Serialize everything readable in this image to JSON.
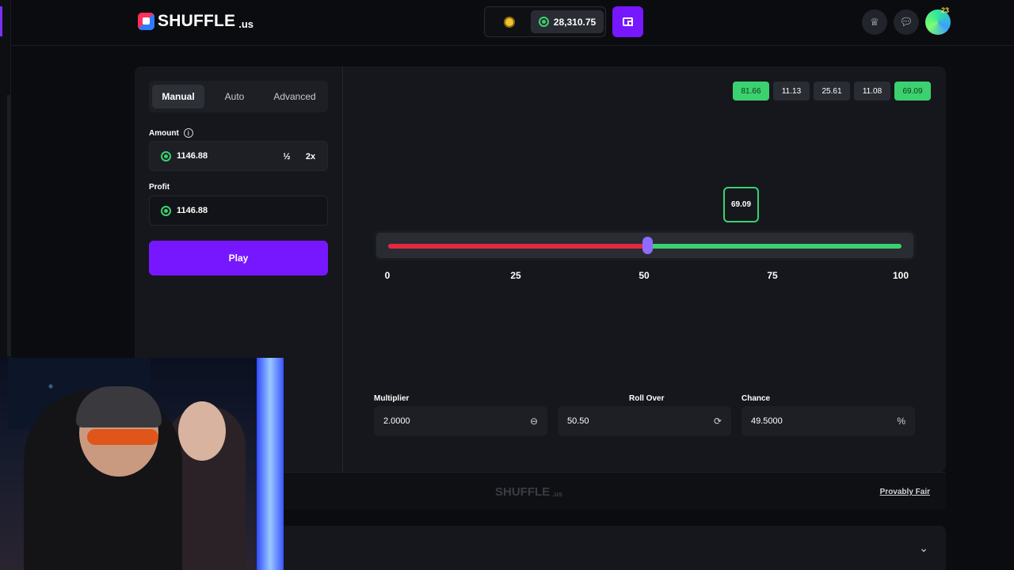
{
  "header": {
    "logo_text": "SHUFFLE",
    "logo_suffix": ".us",
    "balance": "28,310.75",
    "icons": [
      "coin-icon",
      "wallet-icon",
      "crown-icon",
      "chat-icon"
    ],
    "avatar_badge": "23"
  },
  "controls": {
    "tabs": [
      "Manual",
      "Auto",
      "Advanced"
    ],
    "active_tab": "Manual",
    "amount_label": "Amount",
    "amount_value": "1146.88",
    "half_label": "½",
    "double_label": "2x",
    "profit_label": "Profit",
    "profit_value": "1146.88",
    "play_label": "Play"
  },
  "game": {
    "history": [
      {
        "value": "81.66",
        "win": true
      },
      {
        "value": "11.13",
        "win": false
      },
      {
        "value": "25.61",
        "win": false
      },
      {
        "value": "11.08",
        "win": false
      },
      {
        "value": "69.09",
        "win": true
      }
    ],
    "result": "69.09",
    "slider_value": 50.5,
    "scale_ticks": [
      "0",
      "25",
      "50",
      "75",
      "100"
    ],
    "multiplier_label": "Multiplier",
    "multiplier_value": "2.0000",
    "roll_over_label": "Roll Over",
    "roll_over_value": "50.50",
    "chance_label": "Chance",
    "chance_value": "49.5000",
    "chance_unit": "%"
  },
  "footer": {
    "logo_text": "SHUFFLE",
    "logo_suffix": ".us",
    "provably_fair": "Provably Fair"
  },
  "colors": {
    "accent": "#7717ff",
    "win": "#3bd16f",
    "lose": "#e5283f",
    "thumb": "#8f6bff"
  }
}
